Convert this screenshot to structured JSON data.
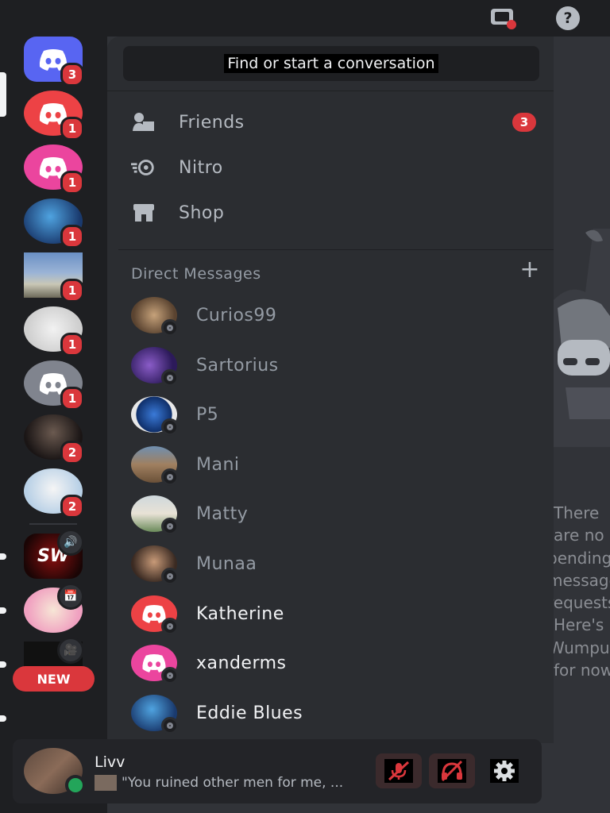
{
  "search": {
    "placeholder_text": "Find or start a conversation"
  },
  "nav": [
    {
      "label": "Friends",
      "icon": "friends-icon",
      "badge": "3"
    },
    {
      "label": "Nitro",
      "icon": "nitro-icon"
    },
    {
      "label": "Shop",
      "icon": "shop-icon"
    }
  ],
  "dm_section": {
    "header": "Direct Messages",
    "add_icon": "plus-icon"
  },
  "dms": [
    {
      "name": "Curios99",
      "unread": false
    },
    {
      "name": "Sartorius",
      "unread": false
    },
    {
      "name": "P5",
      "unread": false
    },
    {
      "name": "Mani",
      "unread": false
    },
    {
      "name": "Matty",
      "unread": false
    },
    {
      "name": "Munaa",
      "unread": false
    },
    {
      "name": "Katherine",
      "unread": true
    },
    {
      "name": "xanderms",
      "unread": true
    },
    {
      "name": "Eddie Blues",
      "unread": true
    }
  ],
  "servers": {
    "badges": [
      "3",
      "1",
      "1",
      "1",
      "1",
      "1",
      "1",
      "2",
      "2"
    ],
    "new_label": "NEW"
  },
  "empty_state": {
    "lines": [
      "There",
      "are no",
      "pending",
      "message",
      "requests.",
      "Here's",
      "Wumpus",
      "for now."
    ]
  },
  "user": {
    "name": "Livv",
    "status": "\"You ruined other men for me, ..."
  },
  "colors": {
    "accent": "#5865f2",
    "danger": "#da373c",
    "online": "#23a55a",
    "pink": "#eb459e"
  }
}
